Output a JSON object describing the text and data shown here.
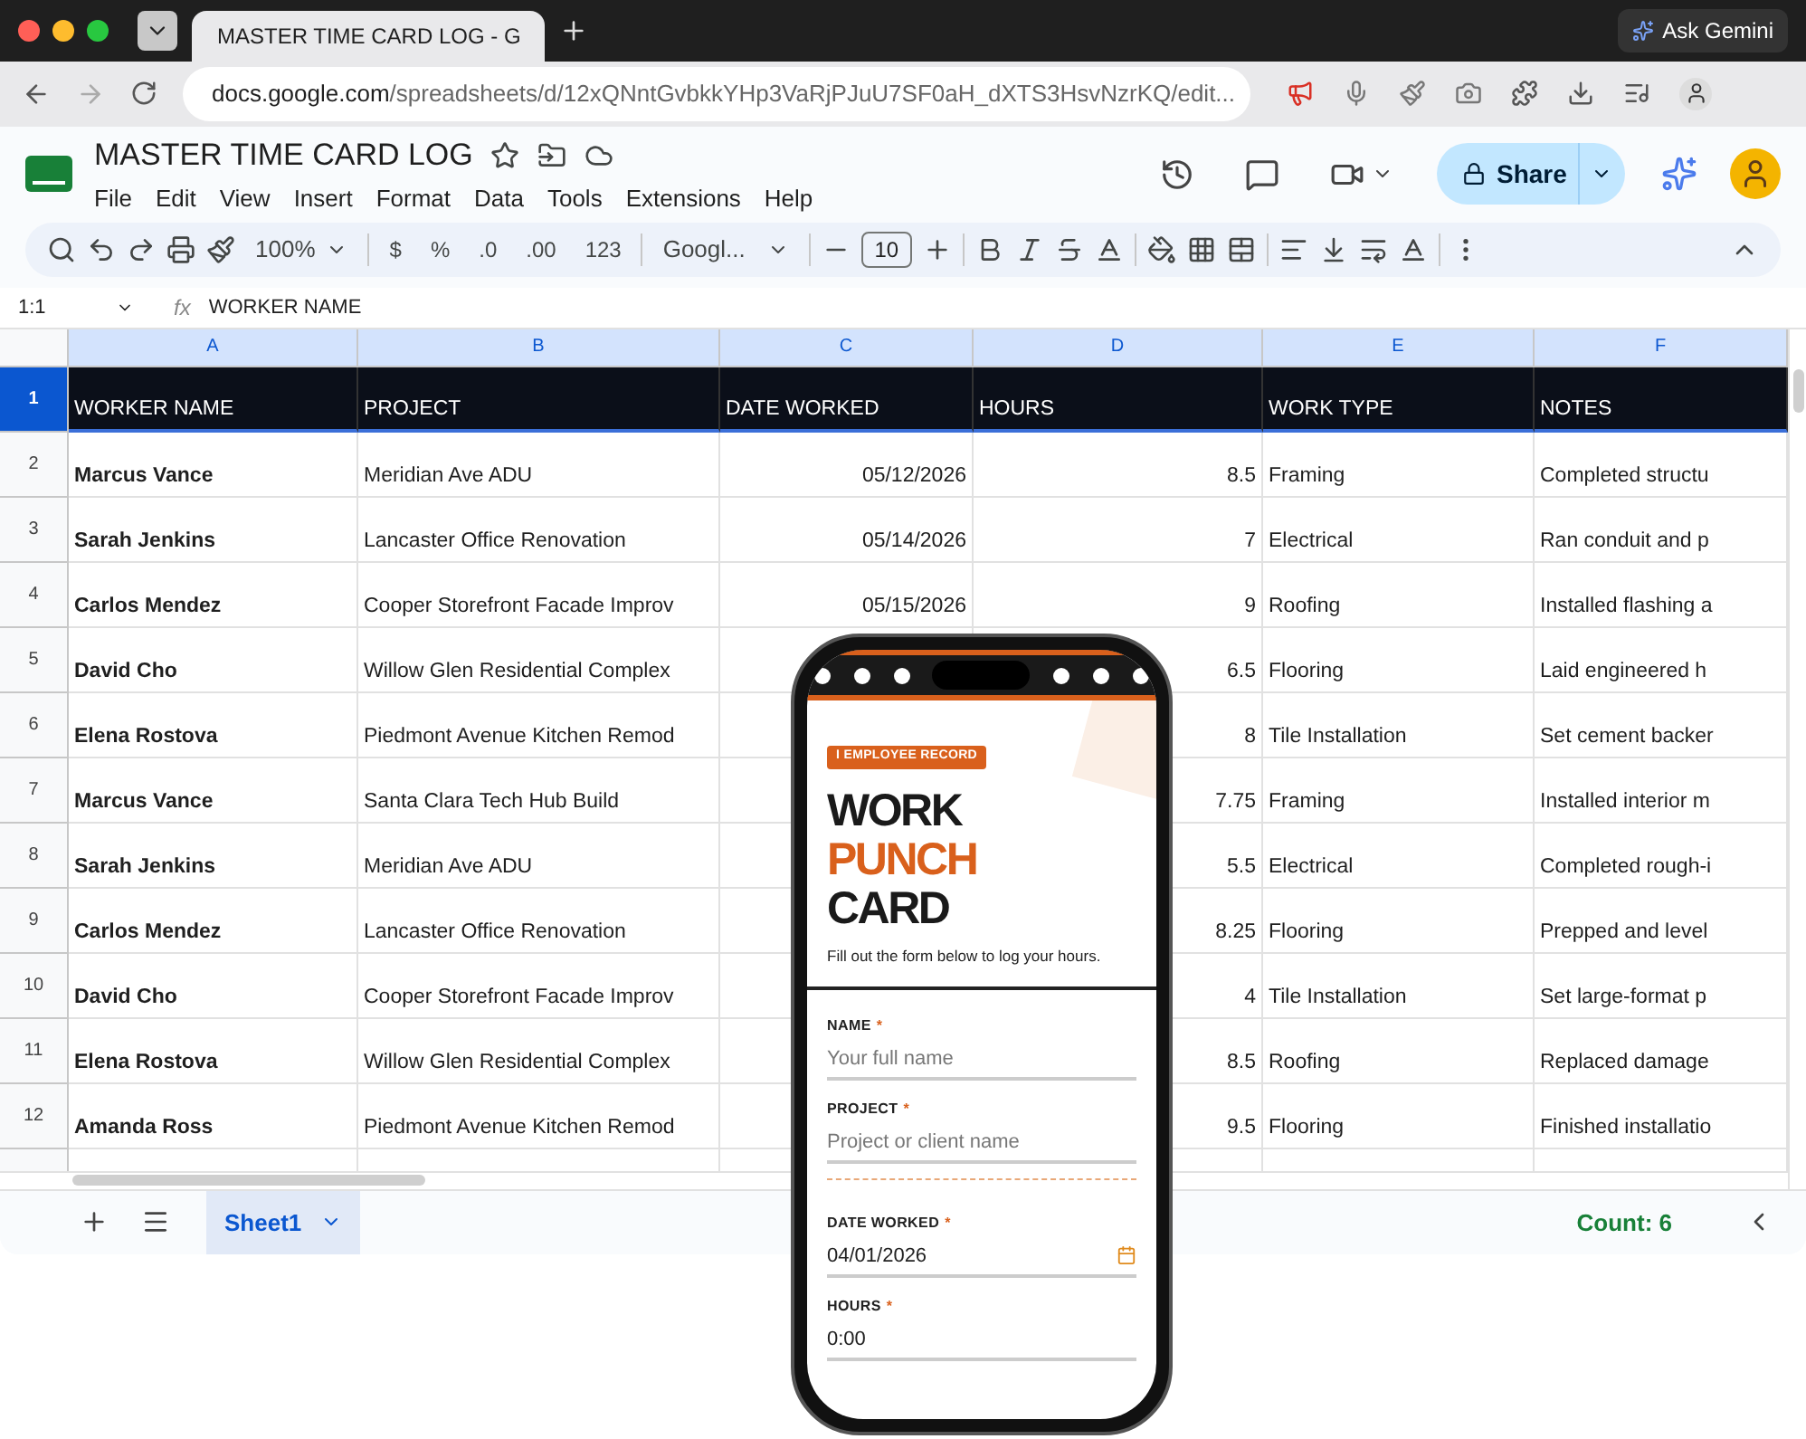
{
  "browser": {
    "tab_title": "MASTER TIME CARD LOG - G",
    "url_host": "docs.google.com",
    "url_path": "/spreadsheets/d/12xQNntGvbkkYHp3VaRjPJuU7SF0aH_dXTS3HsvNzrKQ/edit...",
    "gemini_button": "Ask Gemini"
  },
  "doc": {
    "title": "MASTER TIME CARD LOG",
    "menu": [
      "File",
      "Edit",
      "View",
      "Insert",
      "Format",
      "Data",
      "Tools",
      "Extensions",
      "Help"
    ],
    "share": "Share"
  },
  "toolbar": {
    "zoom": "100%",
    "currency": "$",
    "percent": "%",
    "dec_decrease": ".0",
    "dec_increase": ".00",
    "number_format": "123",
    "font": "Googl...",
    "font_size": "10"
  },
  "formula_bar": {
    "name_box": "1:1",
    "fx_label": "fx",
    "value": "WORKER NAME"
  },
  "sheet": {
    "columns": [
      {
        "letter": "A",
        "selected": true
      },
      {
        "letter": "B",
        "selected": true
      },
      {
        "letter": "C",
        "selected": true
      },
      {
        "letter": "D",
        "selected": true
      },
      {
        "letter": "E",
        "selected": true
      },
      {
        "letter": "F",
        "selected": true
      }
    ],
    "header_row": {
      "number": "1",
      "selected": true,
      "cells": [
        "WORKER NAME",
        "PROJECT",
        "DATE WORKED",
        "HOURS",
        "WORK TYPE",
        "NOTES"
      ]
    },
    "rows": [
      {
        "number": "2",
        "selected": false,
        "worker": "Marcus Vance",
        "project": "Meridian Ave ADU",
        "date": "05/12/2026",
        "hours": "8.5",
        "work_type": "Framing",
        "notes": "Completed structu"
      },
      {
        "number": "3",
        "selected": false,
        "worker": "Sarah Jenkins",
        "project": "Lancaster Office Renovation",
        "date": "05/14/2026",
        "hours": "7",
        "work_type": "Electrical",
        "notes": "Ran conduit and p"
      },
      {
        "number": "4",
        "selected": false,
        "worker": "Carlos Mendez",
        "project": "Cooper Storefront Facade Improv",
        "date": "05/15/2026",
        "hours": "9",
        "work_type": "Roofing",
        "notes": "Installed flashing a"
      },
      {
        "number": "5",
        "selected": false,
        "worker": "David Cho",
        "project": "Willow Glen Residential Complex",
        "hours": "6.5",
        "work_type": "Flooring",
        "notes": "Laid engineered h"
      },
      {
        "number": "6",
        "selected": false,
        "worker": "Elena Rostova",
        "project": "Piedmont Avenue Kitchen Remod",
        "hours": "8",
        "work_type": "Tile Installation",
        "notes": "Set cement backer"
      },
      {
        "number": "7",
        "selected": false,
        "worker": "Marcus Vance",
        "project": "Santa Clara Tech Hub Build",
        "hours": "7.75",
        "work_type": "Framing",
        "notes": "Installed interior m"
      },
      {
        "number": "8",
        "selected": false,
        "worker": "Sarah Jenkins",
        "project": "Meridian Ave ADU",
        "hours": "5.5",
        "work_type": "Electrical",
        "notes": "Completed rough-i"
      },
      {
        "number": "9",
        "selected": false,
        "worker": "Carlos Mendez",
        "project": "Lancaster Office Renovation",
        "hours": "8.25",
        "work_type": "Flooring",
        "notes": "Prepped and level"
      },
      {
        "number": "10",
        "selected": false,
        "worker": "David Cho",
        "project": "Cooper Storefront Facade Improv",
        "hours": "4",
        "work_type": "Tile Installation",
        "notes": "Set large-format p"
      },
      {
        "number": "11",
        "selected": false,
        "worker": "Elena Rostova",
        "project": "Willow Glen Residential Complex",
        "hours": "8.5",
        "work_type": "Roofing",
        "notes": "Replaced damage"
      },
      {
        "number": "12",
        "selected": false,
        "worker": "Amanda Ross",
        "project": "Piedmont Avenue Kitchen Remod",
        "hours": "9.5",
        "work_type": "Flooring",
        "notes": "Finished installatio"
      }
    ]
  },
  "sheet_tabs": [
    {
      "label": "Sheet1",
      "selected": true
    }
  ],
  "status": "Count: 6",
  "phone_form": {
    "badge": "I EMPLOYEE RECORD",
    "title_lines": [
      {
        "text": "WORK",
        "accent": false
      },
      {
        "text": "PUNCH",
        "accent": true
      },
      {
        "text": "CARD",
        "accent": false
      }
    ],
    "subtitle": "Fill out the form below to log your hours.",
    "fields": [
      {
        "kind": "text",
        "label": "NAME",
        "required_mark": "*",
        "placeholder": "Your full name"
      },
      {
        "kind": "text",
        "label": "PROJECT",
        "required_mark": "*",
        "placeholder": "Project or client name"
      },
      {
        "kind": "divider"
      },
      {
        "kind": "date",
        "label": "DATE WORKED",
        "required_mark": "*",
        "value": "04/01/2026"
      },
      {
        "kind": "text",
        "label": "HOURS",
        "required_mark": "*",
        "value": "0:00"
      }
    ]
  }
}
